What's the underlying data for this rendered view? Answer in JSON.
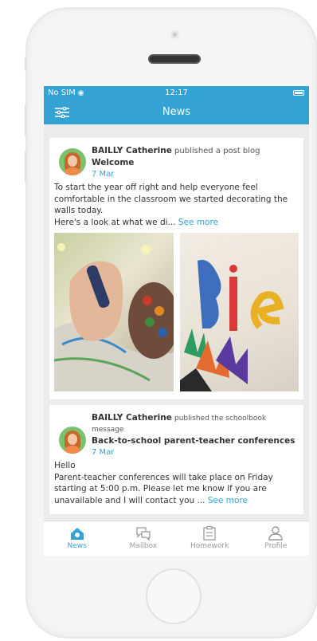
{
  "status_bar": {
    "carrier": "No SIM",
    "time": "12:17"
  },
  "navbar": {
    "title": "News"
  },
  "posts": [
    {
      "author": "BAILLY Catherine",
      "action": "published a post blog",
      "title": "Welcome",
      "date": "7 Mar",
      "body": "To start the year off right and help everyone feel comfortable in the classroom we started decorating the walls today.",
      "body2": "Here's a look at what we di...",
      "see_more": "See more"
    },
    {
      "author": "BAILLY Catherine",
      "action": "published the schoolbook message",
      "title": "Back-to-school parent-teacher conferences",
      "date": "7 Mar",
      "body": "Hello",
      "body2": "Parent-teacher conferences will take place on Friday starting at 5:00 p.m. Please let me know if you are unavailable and I will contact you ...",
      "see_more": "See more"
    }
  ],
  "tabs": [
    {
      "label": "News",
      "icon": "home-icon",
      "active": true
    },
    {
      "label": "Mailbox",
      "icon": "chat-icon",
      "active": false
    },
    {
      "label": "Homework",
      "icon": "clipboard-icon",
      "active": false
    },
    {
      "label": "Profile",
      "icon": "user-icon",
      "active": false
    }
  ],
  "colors": {
    "accent": "#34a2d3",
    "background": "#ebebeb"
  }
}
